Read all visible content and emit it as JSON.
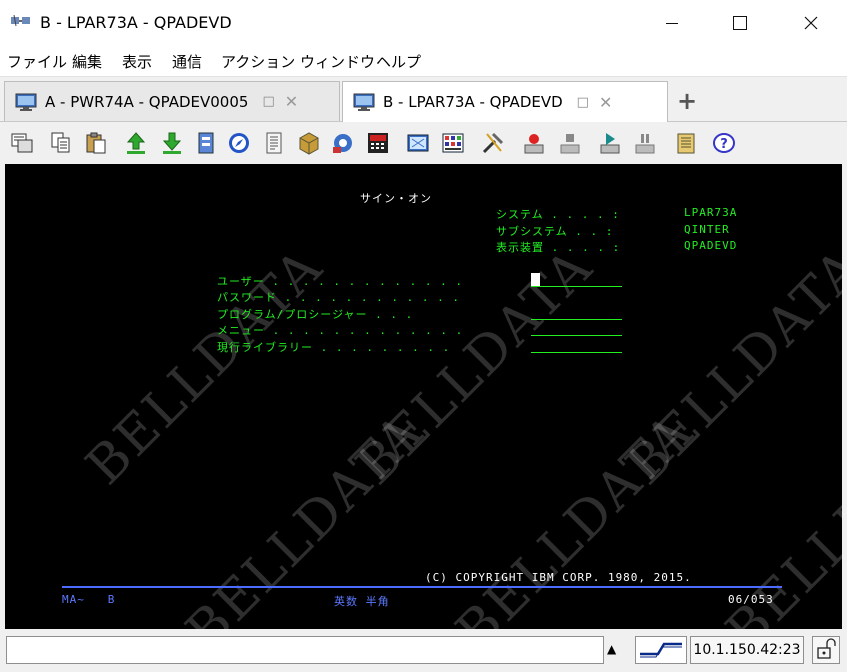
{
  "window": {
    "title": "B - LPAR73A - QPADEVD",
    "controls": [
      "minimize-icon",
      "maximize-icon",
      "close-icon"
    ]
  },
  "menu": {
    "items": [
      "ファイル",
      "編集",
      "表示",
      "通信",
      "アクション",
      "ウィンドウ",
      "ヘルプ"
    ]
  },
  "tabs": [
    {
      "label": "A - PWR74A - QPADEV0005",
      "active": false
    },
    {
      "label": "B - LPAR73A - QPADEVD",
      "active": true
    }
  ],
  "toolbar": {
    "icons": [
      "copy-screen-icon",
      "copy-icon",
      "paste-icon",
      "send-file-icon",
      "receive-file-icon",
      "print-screen-icon",
      "navigator-icon",
      "notes-icon",
      "package-icon",
      "macro-icon",
      "keyboard-icon",
      "display-icon",
      "keypad-icon",
      "tools-icon",
      "record-icon",
      "stop-icon",
      "play-icon",
      "pause-icon",
      "clipboard-icon",
      "help-icon"
    ]
  },
  "terminal": {
    "title": "サイン・オン",
    "system_label": "システム . . . . :",
    "system_value": "LPAR73A",
    "subsystem_label": "サブシステム . . :",
    "subsystem_value": "QINTER",
    "display_label": "表示装置 . . . . :",
    "display_value": "QPADEVD",
    "fields": [
      "ユーザー . . . . . . . . . . . . .",
      "パスワード . . . . . . . . . . . .",
      "プログラム/プロシージャー . . .",
      "メニュー . . . . . . . . . . . . .",
      "現行ライブラリー . . . . . . . . ."
    ],
    "copyright": "(C) COPYRIGHT IBM CORP. 1980, 2015.",
    "oia_left": "MA~   B",
    "oia_mode": "英数 半角",
    "oia_pos": "06/053",
    "watermark": "BELLDATA"
  },
  "status": {
    "ip": "10.1.150.42:23",
    "scroll_icon": "scroll-up-icon",
    "connection_icon": "connection-status-icon",
    "lock_icon": "lock-icon"
  },
  "colors": {
    "terminal_bg": "#000000",
    "green": "#22ee22",
    "blue": "#4d6cff"
  }
}
